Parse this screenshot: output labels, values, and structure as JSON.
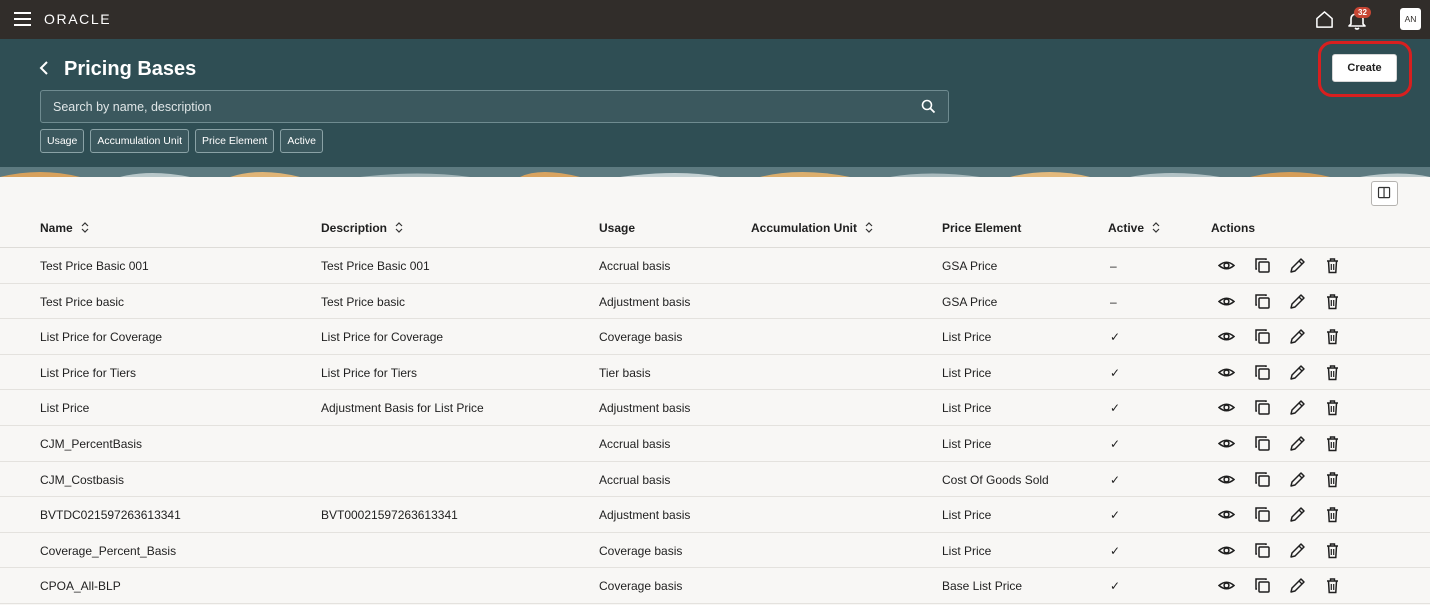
{
  "app": {
    "brand": "ORACLE",
    "notification_count": "32",
    "user_initials": "AN"
  },
  "page": {
    "title": "Pricing Bases",
    "create_label": "Create",
    "search_placeholder": "Search by name, description",
    "filter_chips": [
      "Usage",
      "Accumulation Unit",
      "Price Element",
      "Active"
    ]
  },
  "table": {
    "columns": [
      {
        "label": "Name",
        "sortable": true
      },
      {
        "label": "Description",
        "sortable": true
      },
      {
        "label": "Usage",
        "sortable": false
      },
      {
        "label": "Accumulation Unit",
        "sortable": true
      },
      {
        "label": "Price Element",
        "sortable": false
      },
      {
        "label": "Active",
        "sortable": true
      },
      {
        "label": "Actions",
        "sortable": false
      }
    ],
    "rows": [
      {
        "name": "Test Price Basic 001",
        "description": "Test Price Basic 001",
        "usage": "Accrual basis",
        "accumulation_unit": "",
        "price_element": "GSA Price",
        "active": "–"
      },
      {
        "name": "Test Price basic",
        "description": "Test Price basic",
        "usage": "Adjustment basis",
        "accumulation_unit": "",
        "price_element": "GSA Price",
        "active": "–"
      },
      {
        "name": "List Price for Coverage",
        "description": "List Price for Coverage",
        "usage": "Coverage basis",
        "accumulation_unit": "",
        "price_element": "List Price",
        "active": "✓"
      },
      {
        "name": "List Price for Tiers",
        "description": "List Price for Tiers",
        "usage": "Tier basis",
        "accumulation_unit": "",
        "price_element": "List Price",
        "active": "✓"
      },
      {
        "name": "List Price",
        "description": "Adjustment Basis for List Price",
        "usage": "Adjustment basis",
        "accumulation_unit": "",
        "price_element": "List Price",
        "active": "✓"
      },
      {
        "name": "CJM_PercentBasis",
        "description": "",
        "usage": "Accrual basis",
        "accumulation_unit": "",
        "price_element": "List Price",
        "active": "✓"
      },
      {
        "name": "CJM_Costbasis",
        "description": "",
        "usage": "Accrual basis",
        "accumulation_unit": "",
        "price_element": "Cost Of Goods Sold",
        "active": "✓"
      },
      {
        "name": "BVTDC021597263613341",
        "description": "BVT00021597263613341",
        "usage": "Adjustment basis",
        "accumulation_unit": "",
        "price_element": "List Price",
        "active": "✓"
      },
      {
        "name": "Coverage_Percent_Basis",
        "description": "",
        "usage": "Coverage basis",
        "accumulation_unit": "",
        "price_element": "List Price",
        "active": "✓"
      },
      {
        "name": "CPOA_All-BLP",
        "description": "",
        "usage": "Coverage basis",
        "accumulation_unit": "",
        "price_element": "Base List Price",
        "active": "✓"
      }
    ],
    "row_actions": [
      "eye-icon",
      "copy-icon",
      "pencil-icon",
      "trash-icon"
    ]
  },
  "colors": {
    "topbar": "#312d2a",
    "header": "#2f4e54",
    "badge": "#c74634",
    "highlight": "#d81f1f"
  }
}
